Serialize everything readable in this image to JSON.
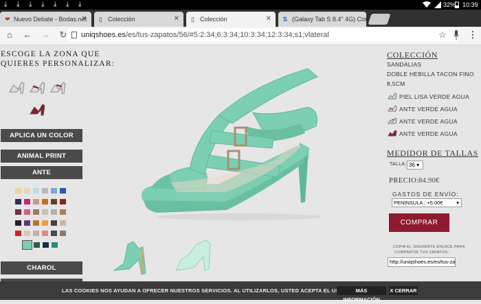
{
  "statusbar": {
    "battery_text": "32%",
    "time": "10:39",
    "download_icon_glyph": "⤓"
  },
  "tabs": [
    {
      "label": "Nuevo Debate - Bodas.net",
      "favicon": "❤",
      "active": false
    },
    {
      "label": "Colección",
      "favicon": "▯",
      "active": false
    },
    {
      "label": "Colección",
      "favicon": "▯",
      "active": true
    },
    {
      "label": "(Galaxy Tab S 8.4\" 4G) Com",
      "favicon": "S",
      "active": false
    }
  ],
  "toolbar": {
    "url_domain": "uniqshoes.es",
    "url_path": "/es/tus-zapatos/56/#5:2:34;6:3:34;10:3:34;12:3:34;s1;vlateral"
  },
  "customizer": {
    "heading_line1": "ESCOGE LA ZONA QUE",
    "heading_line2": "QUIERES PERSONALIZAR:",
    "buttons": {
      "aplica_color": "APLICA UN COLOR",
      "animal_print": "ANIMAL PRINT",
      "ante": "ANTE",
      "charol": "CHAROL"
    },
    "swatch_colors": [
      "#e8d5a0",
      "#e8d8b0",
      "#c0d8e8",
      "#b8b8b8",
      "#7aa8d8",
      "#3355aa",
      "#2d2d5a",
      "#cc2277",
      "#c0a080",
      "#cc6622",
      "#6b3a2a",
      "#8b2020",
      "#7a2a4a",
      "#d06080",
      "#9a7a66",
      "#c8c0b0",
      "#b0b0b0",
      "#b08050",
      "#222222",
      "#5a3a7a",
      "#c07030",
      "#e8a040",
      "#444444",
      "#ccb8a0",
      "#cc2222",
      "#d8c8b0",
      "#ccaaa8",
      "#e08888",
      "#4a4a4a",
      "#8a7a70"
    ],
    "bottom_swatches": [
      "#7ccfb3",
      "#2a5a4a",
      "#1a2a4a",
      "#2a8a7a"
    ]
  },
  "product": {
    "collection_heading": "COLECCIÓN",
    "category": "SANDALIAS",
    "name": "DOBLE HEBILLA TACON FINO",
    "heel_height": "8,5CM",
    "materials": [
      "PIEL LISA VERDE AGUA",
      "ANTE VERDE AGUA",
      "ANTE VERDE AGUA",
      "ANTE VERDE AGUA"
    ],
    "size_heading": "MEDIDOR DE TALLAS",
    "size_label": "TALLA:",
    "size_value": "36 ▾",
    "price_label": "PRECIO:",
    "price_value": "84.90€",
    "shipping_label": "GASTOS DE ENVÍO:",
    "shipping_option": "PENINSULA : +5.00€",
    "buy_button": "COMPRAR",
    "share_line1": "COPIA EL SIGUIENTE ENLACE PARA",
    "share_line2": "COMPARTIR TUS ZAPATOS:",
    "share_url": "http://uniqshoes.es/es/tus-zap"
  },
  "cookie": {
    "text": "LAS COOKIES NOS AYUDAN A OFRECER NUESTROS SERVICIOS. AL UTILIZARLOS, USTED ACEPTA EL USO DE COOKIES.",
    "more_info": "MÁS INFORMACIÓN",
    "close": "X CERRAR"
  },
  "colors": {
    "accent": "#8d1a2e",
    "shoe_mint": "#7ccfb3",
    "button_gray": "#4a4a4a"
  }
}
